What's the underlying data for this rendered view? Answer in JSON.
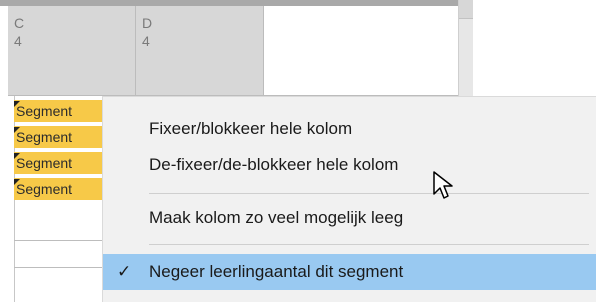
{
  "columns": [
    {
      "letter": "C",
      "count": "4"
    },
    {
      "letter": "D",
      "count": "4"
    }
  ],
  "segments": [
    "Segment",
    "Segment",
    "Segment",
    "Segment"
  ],
  "context_menu": {
    "items": [
      {
        "label": "Fixeer/blokkeer hele kolom"
      },
      {
        "label": "De-fixeer/de-blokkeer hele kolom"
      },
      {
        "label": "Maak kolom zo veel mogelijk leeg"
      },
      {
        "label": "Negeer leerlingaantal dit segment",
        "checked": true,
        "highlighted": true
      }
    ]
  },
  "icons": {
    "check": "checkmark-icon",
    "cursor": "mouse-pointer-icon"
  }
}
